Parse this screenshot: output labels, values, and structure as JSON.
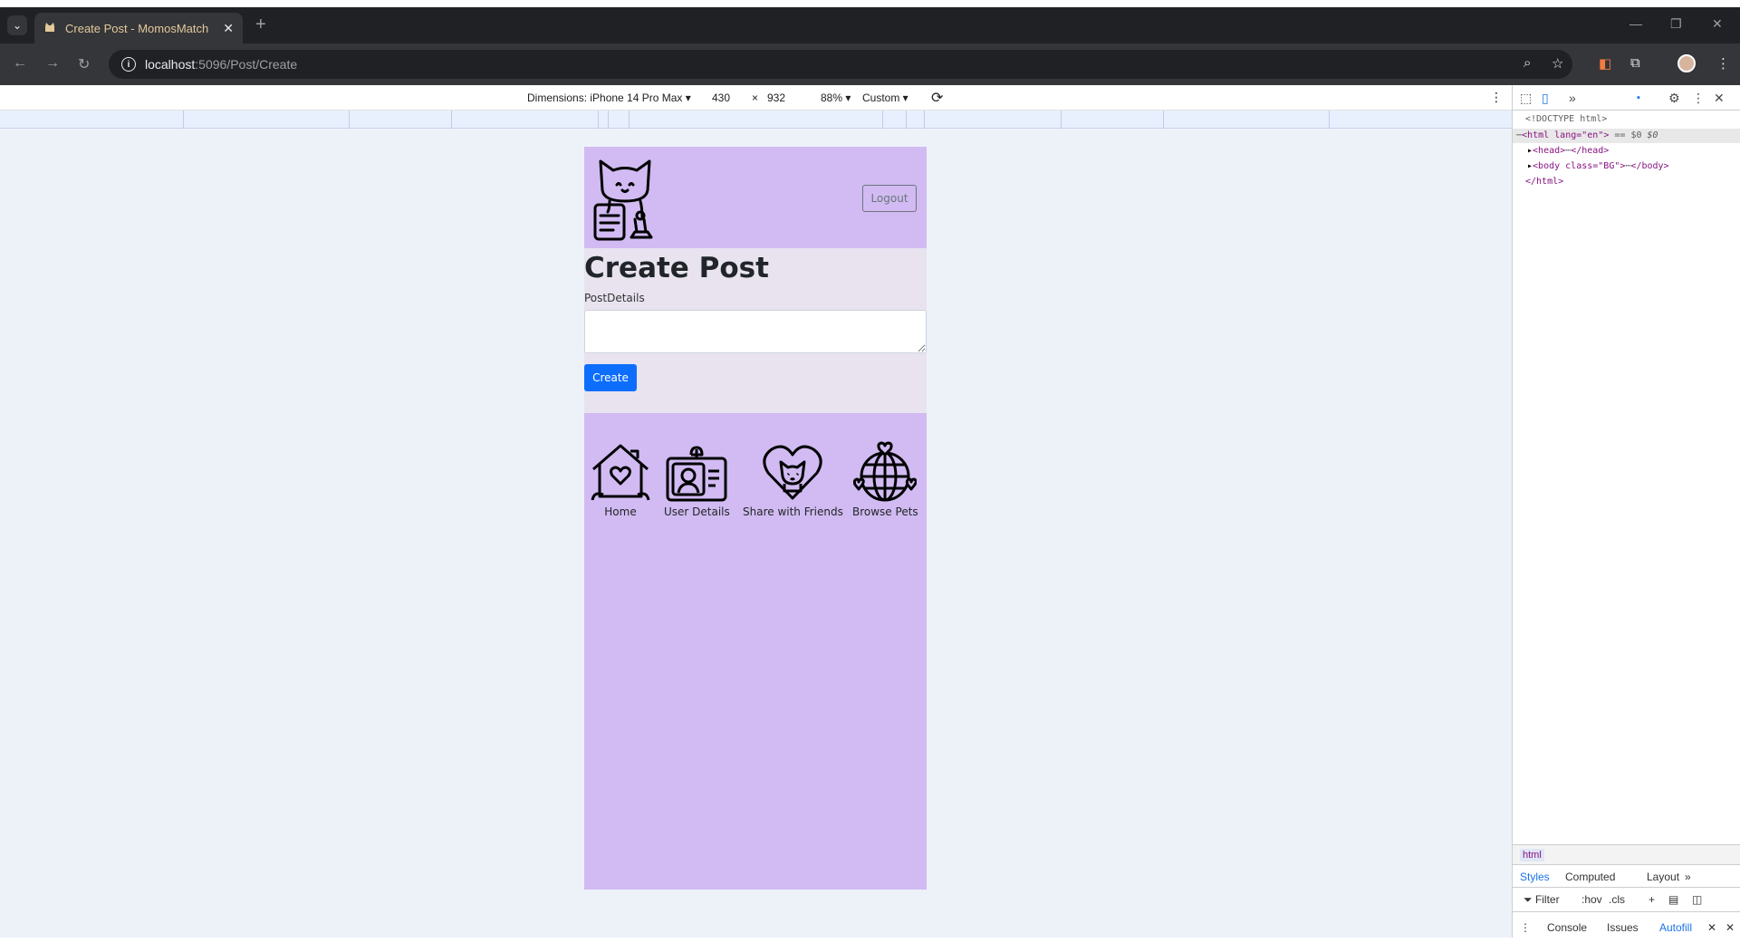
{
  "browser": {
    "tab_title": "Create Post - MomosMatch",
    "url_host": "localhost",
    "url_path": ":5096/Post/Create"
  },
  "device_toolbar": {
    "dimensions_label": "Dimensions: iPhone 14 Pro Max",
    "width": "430",
    "times": "×",
    "height": "932",
    "zoom": "88%",
    "throttle": "Custom"
  },
  "page": {
    "logout_label": "Logout",
    "title": "Create Post",
    "field_label": "PostDetails",
    "input_value": "",
    "create_label": "Create",
    "nav": [
      {
        "label": "Home",
        "icon": "house-heart-icon"
      },
      {
        "label": "User Details",
        "icon": "id-card-icon"
      },
      {
        "label": "Share with Friends",
        "icon": "heart-cat-icon"
      },
      {
        "label": "Browse Pets",
        "icon": "globe-heart-icon"
      }
    ],
    "colors": {
      "header_bg": "#d1bbf2",
      "content_bg": "#e8e3ef",
      "primary": "#0d6efd"
    }
  },
  "devtools": {
    "dom": {
      "doctype": "<!DOCTYPE html>",
      "html_open": "<html lang=\"en\">",
      "html_suffix": "== $0",
      "head": "<head>",
      "head_close": "</head>",
      "body": "<body class=\"BG\">",
      "body_close": "</body>",
      "html_close": "</html>"
    },
    "breadcrumb": "html",
    "tabs": [
      "Styles",
      "Computed",
      "Layout"
    ],
    "filter_label": "Filter",
    "hov": ":hov",
    "cls": ".cls",
    "drawer_tabs": [
      "Console",
      "Issues",
      "Autofill"
    ]
  }
}
